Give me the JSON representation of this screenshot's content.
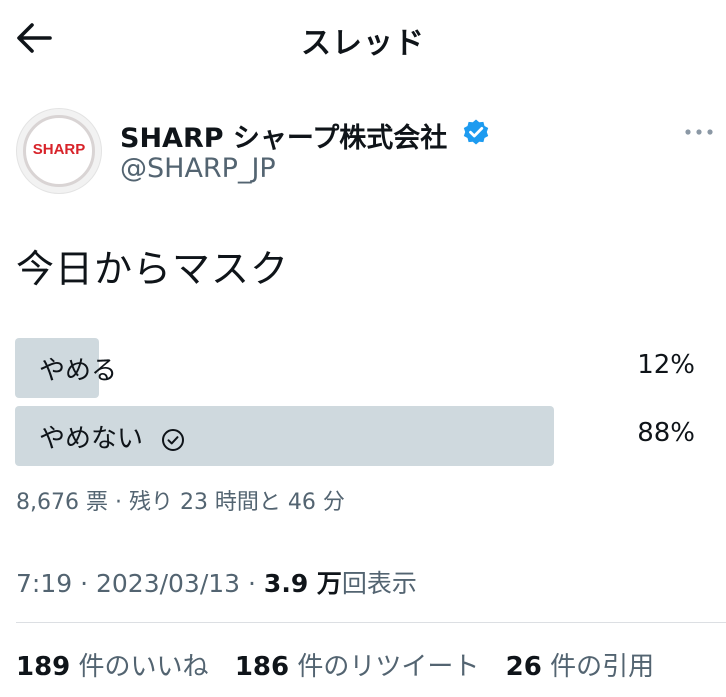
{
  "header": {
    "title": "スレッド"
  },
  "author": {
    "display_name": "SHARP シャープ株式会社",
    "handle": "@SHARP_JP",
    "avatar_logo_text": "SHARP",
    "verified_color": "#1d9bf0"
  },
  "tweet": {
    "text": "今日からマスク"
  },
  "poll": {
    "options": [
      {
        "label": "やめる",
        "percent": 12,
        "percent_text": "12%",
        "winner": false
      },
      {
        "label": "やめない",
        "percent": 88,
        "percent_text": "88%",
        "winner": true
      }
    ],
    "meta": "8,676 票 · 残り 23 時間と 46 分"
  },
  "timestamp": {
    "time_date": "7:19 · 2023/03/13 · ",
    "views_count": "3.9 万",
    "views_label": "回表示"
  },
  "stats": {
    "likes_count": "189",
    "likes_label": "件のいいね",
    "retweets_count": "186",
    "retweets_label": "件のリツイート",
    "quotes_count": "26",
    "quotes_label": "件の引用"
  },
  "colors": {
    "poll_bar": "#cfd9de",
    "secondary_text": "#536471",
    "accent": "#1d9bf0"
  }
}
